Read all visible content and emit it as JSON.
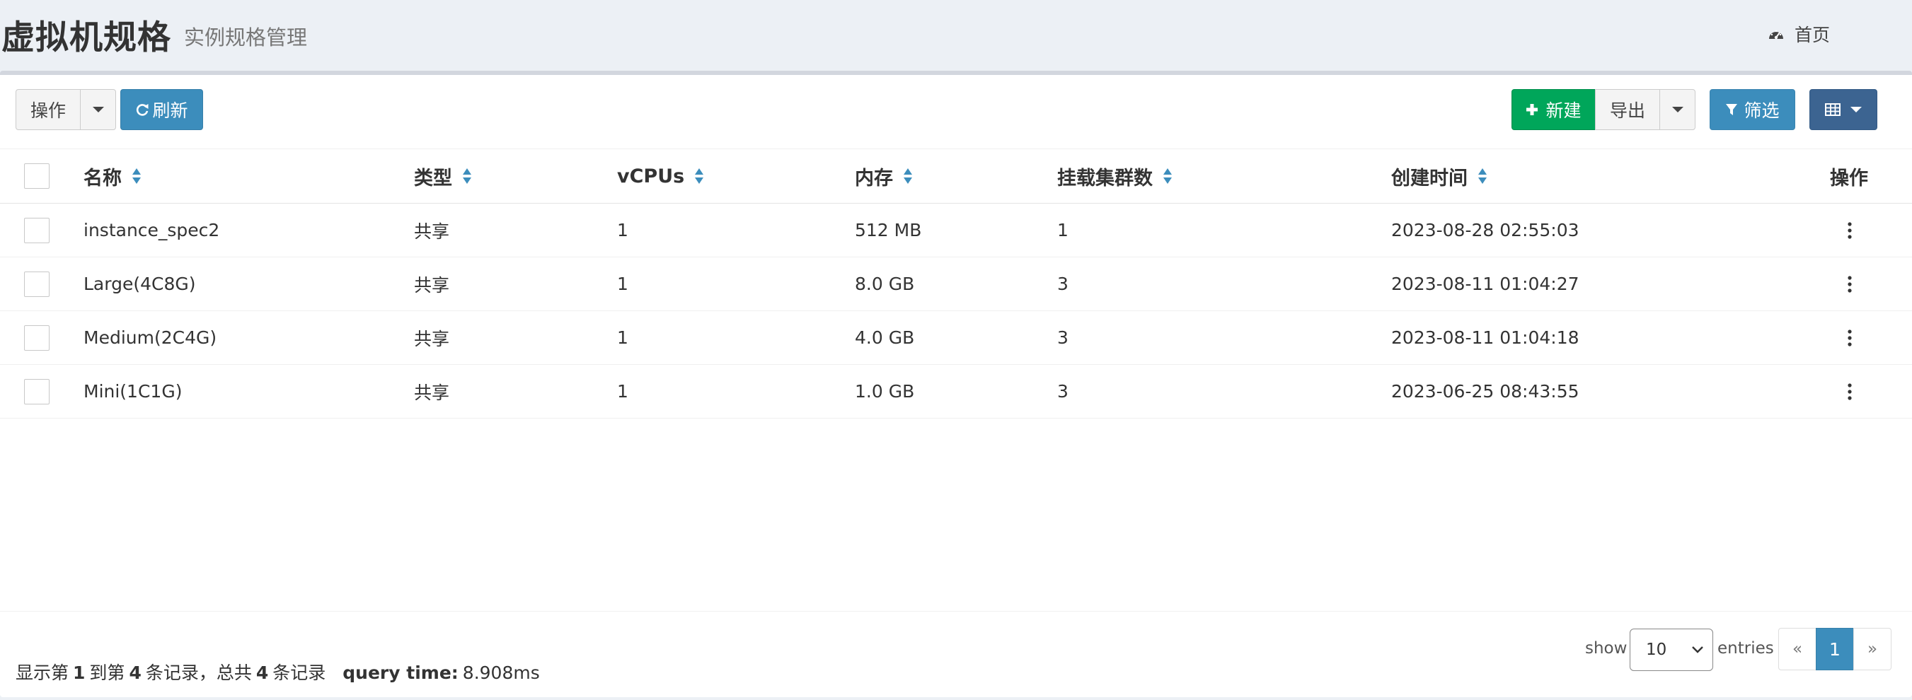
{
  "header": {
    "title": "虚拟机规格",
    "subtitle": "实例规格管理",
    "home_label": "首页"
  },
  "toolbar": {
    "actions_label": "操作",
    "refresh_label": "刷新",
    "new_label": "新建",
    "export_label": "导出",
    "filter_label": "筛选"
  },
  "table": {
    "columns": {
      "name": "名称",
      "type": "类型",
      "vcpus": "vCPUs",
      "memory": "内存",
      "clusters": "挂载集群数",
      "created": "创建时间",
      "actions": "操作"
    },
    "rows": [
      {
        "name": "instance_spec2",
        "type": "共享",
        "vcpus": "1",
        "memory": "512 MB",
        "clusters": "1",
        "created": "2023-08-28 02:55:03"
      },
      {
        "name": "Large(4C8G)",
        "type": "共享",
        "vcpus": "1",
        "memory": "8.0 GB",
        "clusters": "3",
        "created": "2023-08-11 01:04:27"
      },
      {
        "name": "Medium(2C4G)",
        "type": "共享",
        "vcpus": "1",
        "memory": "4.0 GB",
        "clusters": "3",
        "created": "2023-08-11 01:04:18"
      },
      {
        "name": "Mini(1C1G)",
        "type": "共享",
        "vcpus": "1",
        "memory": "1.0 GB",
        "clusters": "3",
        "created": "2023-06-25 08:43:55"
      }
    ]
  },
  "footer": {
    "summary_prefix": "显示第",
    "from": "1",
    "summary_mid1": "到第",
    "to": "4",
    "summary_mid2": "条记录，总共",
    "total": "4",
    "summary_suffix": "条记录",
    "query_time_label": "query time:",
    "query_time_value": "8.908ms",
    "show_label": "show",
    "page_size": "10",
    "entries_label": "entries",
    "prev_label": "«",
    "current_page": "1",
    "next_label": "»"
  },
  "colors": {
    "primary": "#3c8dbc",
    "success": "#00a65a",
    "dark_button": "#3c6491",
    "background": "#ecf0f5"
  },
  "icons": {
    "home": "dashboard-icon",
    "refresh": "refresh-icon",
    "new": "plus-icon",
    "filter": "filter-icon",
    "columns": "table-columns-icon",
    "sort": "sort-icon",
    "row_action": "ellipsis-vertical-icon"
  }
}
